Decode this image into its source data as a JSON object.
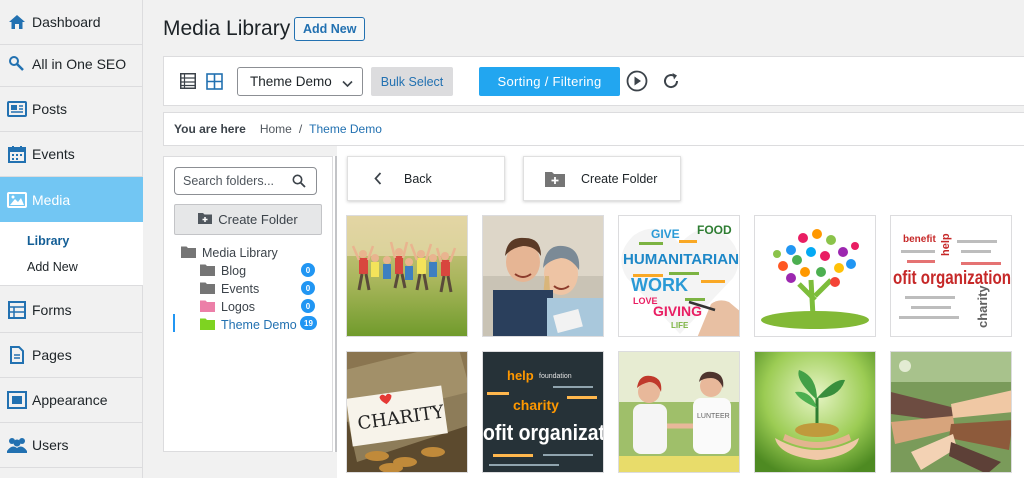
{
  "sidebar": {
    "items": [
      {
        "label": "Dashboard",
        "icon": "dashboard-icon"
      },
      {
        "label": "All in One SEO",
        "icon": "seo-icon"
      },
      {
        "label": "Posts",
        "icon": "posts-icon"
      },
      {
        "label": "Events",
        "icon": "calendar-icon"
      },
      {
        "label": "Media",
        "icon": "media-icon"
      },
      {
        "label": "Forms",
        "icon": "forms-icon"
      },
      {
        "label": "Pages",
        "icon": "pages-icon"
      },
      {
        "label": "Appearance",
        "icon": "appearance-icon"
      },
      {
        "label": "Users",
        "icon": "users-icon"
      }
    ],
    "media_sub": {
      "library": "Library",
      "add_new": "Add New"
    }
  },
  "header": {
    "title": "Media Library",
    "add_new": "Add New"
  },
  "toolbar": {
    "folder_select": "Theme Demo",
    "bulk_select": "Bulk Select",
    "sorting": "Sorting / Filtering"
  },
  "breadcrumb": {
    "label": "You are here",
    "home": "Home",
    "sep": "/",
    "current": "Theme Demo"
  },
  "folders": {
    "search_placeholder": "Search folders...",
    "create": "Create Folder",
    "root": "Media Library",
    "items": [
      {
        "name": "Blog",
        "count": "0",
        "color": "#757575"
      },
      {
        "name": "Events",
        "count": "0",
        "color": "#757575"
      },
      {
        "name": "Logos",
        "count": "0",
        "color": "#ec7fa8"
      },
      {
        "name": "Theme Demo",
        "count": "19",
        "color": "#7ed321"
      }
    ]
  },
  "grid": {
    "back": "Back",
    "create_folder": "Create Folder"
  },
  "thumb_text": {
    "humanitarian": "HUMANITARIAN",
    "give": "GIVE",
    "food": "FOOD",
    "work": "WORK",
    "love": "LOVE",
    "giving": "GIVING",
    "life": "LIFE",
    "benefit": "benefit",
    "help": "help",
    "ofit_org": "ofit organization",
    "charity_v": "charity",
    "charity_jar": "CHARITY",
    "help2": "help",
    "foundation": "foundation",
    "charity2": "charity",
    "ofit_org2": "ofit organizat",
    "volunteer": "LUNTEER"
  }
}
